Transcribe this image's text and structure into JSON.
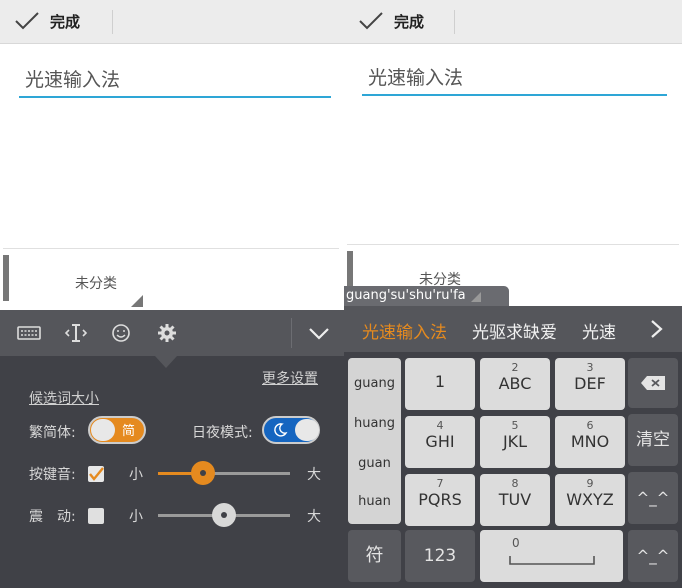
{
  "left": {
    "topbar": {
      "done_label": "完成"
    },
    "textfield": {
      "value": "光速输入法"
    },
    "category": {
      "label": "未分类"
    },
    "settings": {
      "more_settings": "更多设置",
      "candidate_size": "候选词大小",
      "traditional_simplified": {
        "label": "繁简体:",
        "value": "简"
      },
      "night_mode": {
        "label": "日夜模式:"
      },
      "key_sound": {
        "label": "按键音:",
        "min": "小",
        "max": "大",
        "level": 0.34
      },
      "vibration": {
        "label": "震　动:",
        "min": "小",
        "max": "大",
        "level": 0.5
      },
      "colors": {
        "accent": "#e58a1f",
        "night_blue": "#1565c0"
      }
    }
  },
  "right": {
    "topbar": {
      "done_label": "完成"
    },
    "textfield": {
      "value": "光速输入法"
    },
    "category": {
      "label": "未分类"
    },
    "suggestion": "guang'su'shu'ru'fa",
    "candidates": [
      "光速输入法",
      "光驱求缺爱",
      "光速"
    ],
    "pinyin": [
      "guang",
      "huang",
      "guan",
      "huan"
    ],
    "keys": [
      {
        "num": "",
        "letters": "1"
      },
      {
        "num": "2",
        "letters": "ABC"
      },
      {
        "num": "3",
        "letters": "DEF"
      },
      {
        "num": "4",
        "letters": "GHI"
      },
      {
        "num": "5",
        "letters": "JKL"
      },
      {
        "num": "6",
        "letters": "MNO"
      },
      {
        "num": "7",
        "letters": "PQRS"
      },
      {
        "num": "8",
        "letters": "TUV"
      },
      {
        "num": "9",
        "letters": "WXYZ"
      }
    ],
    "side_keys": {
      "clear": "清空",
      "emoticon": "^_^"
    },
    "bottom_keys": {
      "symbol": "符",
      "num": "123",
      "zero": "0"
    }
  }
}
